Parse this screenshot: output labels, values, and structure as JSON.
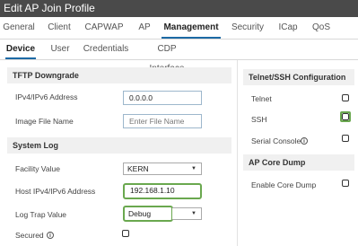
{
  "window": {
    "title": "Edit AP Join Profile"
  },
  "main_tabs": [
    "General",
    "Client",
    "CAPWAP",
    "AP",
    "Management",
    "Security",
    "ICap",
    "QoS"
  ],
  "sub_tabs": [
    "Device",
    "User",
    "Credentials",
    "CDP Interface"
  ],
  "tftp": {
    "heading": "TFTP Downgrade",
    "ip_label": "IPv4/IPv6 Address",
    "ip_value": "0.0.0.0",
    "image_label": "Image File Name",
    "image_placeholder": "Enter File Name"
  },
  "syslog": {
    "heading": "System Log",
    "facility_label": "Facility Value",
    "facility_value": "KERN",
    "host_label": "Host IPv4/IPv6 Address",
    "host_value": "192.168.1.10",
    "trap_label": "Log Trap Value",
    "trap_value": "Debug",
    "secured_label": "Secured"
  },
  "telnet_ssh": {
    "heading": "Telnet/SSH Configuration",
    "telnet_label": "Telnet",
    "ssh_label": "SSH",
    "serial_label": "Serial Console"
  },
  "core_dump": {
    "heading": "AP Core Dump",
    "enable_label": "Enable Core Dump"
  },
  "icons": {
    "info": "info-icon",
    "caret": "caret-down-icon"
  },
  "colors": {
    "title_bg": "#4a4a4a",
    "active_tab_underline": "#1d6aa5",
    "highlight": "#6aa84f"
  }
}
